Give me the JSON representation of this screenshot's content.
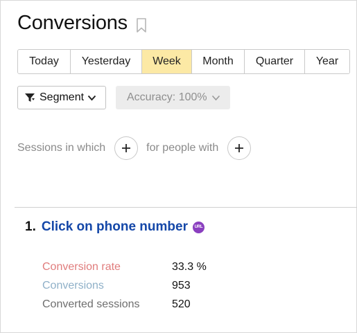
{
  "header": {
    "title": "Conversions"
  },
  "periods": [
    "Today",
    "Yesterday",
    "Week",
    "Month",
    "Quarter",
    "Year"
  ],
  "active_period": "Week",
  "segment": {
    "label": "Segment"
  },
  "accuracy": {
    "label": "Accuracy: 100%"
  },
  "filters": {
    "sessions_text": "Sessions in which",
    "people_text": "for people with"
  },
  "goal": {
    "number": "1.",
    "name": "Click on phone number",
    "badge": "URL",
    "metrics": [
      {
        "label": "Conversion rate",
        "value": "33.3 %",
        "color": "#e07c7c"
      },
      {
        "label": "Conversions",
        "value": "953",
        "color": "#8fb0c8"
      },
      {
        "label": "Converted sessions",
        "value": "520",
        "color": "#6e6e6e"
      }
    ]
  },
  "colors": {
    "active_period_bg": "#fce9a5",
    "goal_link": "#1447a8",
    "badge": "#8a3fbf"
  }
}
